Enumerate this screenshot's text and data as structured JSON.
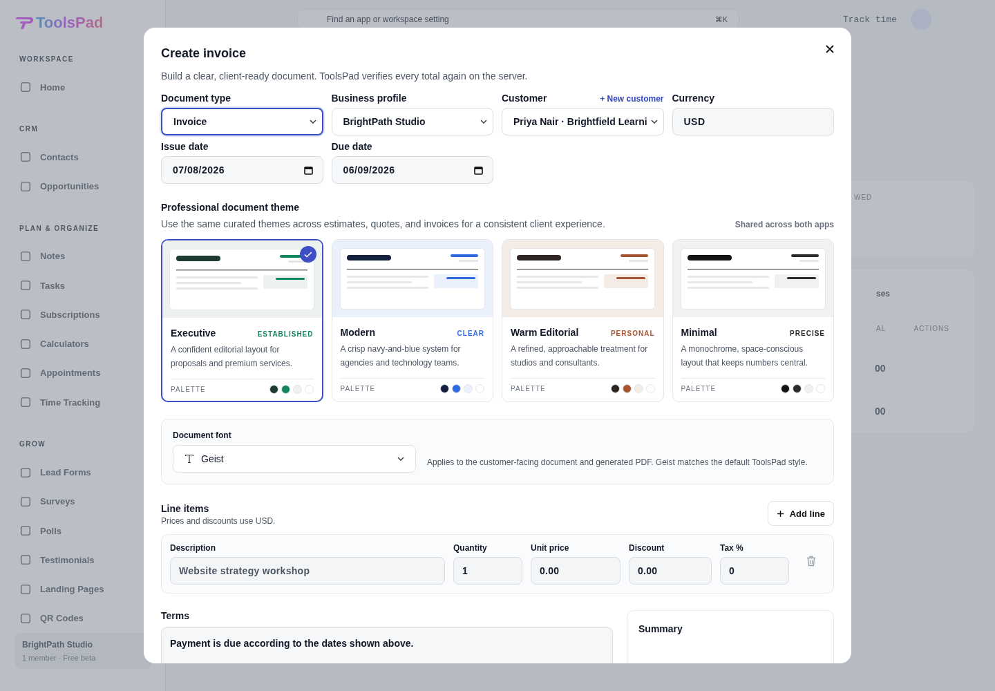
{
  "app": {
    "logo": "ToolsPad",
    "sidebar": [
      {
        "heading": "WORKSPACE",
        "items": [
          "Home"
        ]
      },
      {
        "heading": "CRM",
        "items": [
          "Contacts",
          "Opportunities"
        ]
      },
      {
        "heading": "PLAN & ORGANIZE",
        "items": [
          "Notes",
          "Tasks",
          "Subscriptions",
          "Calculators",
          "Appointments",
          "Time Tracking"
        ]
      },
      {
        "heading": "GROW",
        "items": [
          "Lead Forms",
          "Surveys",
          "Polls",
          "Testimonials",
          "Landing Pages",
          "QR Codes"
        ]
      }
    ],
    "workspace": {
      "name": "BrightPath Studio",
      "meta": "1 member · Free beta"
    },
    "search": {
      "placeholder": "Find an app or workspace setting",
      "shortcut": "⌘K"
    },
    "track_time": "Track time",
    "background_fragments": {
      "card_label": "WED",
      "select_value": "ses",
      "column_1": "AL",
      "column_2": "ACTIONS",
      "rows": [
        "00",
        "00"
      ]
    }
  },
  "dialog": {
    "title": "Create invoice",
    "subtitle": "Build a clear, client-ready document. ToolsPad verifies every total again on the server.",
    "fields": [
      {
        "label": "Document type",
        "kind": "select",
        "value": "Invoice",
        "focused": true
      },
      {
        "label": "Business profile",
        "kind": "select",
        "value": "BrightPath Studio",
        "focused": false
      },
      {
        "label": "Customer",
        "kind": "select",
        "value": "Priya Nair · Brightfield Learni",
        "focused": false,
        "action": "+ New customer"
      },
      {
        "label": "Currency",
        "kind": "text",
        "value": "USD",
        "focused": false
      },
      {
        "label": "Issue date",
        "kind": "date",
        "value": "07/08/2026",
        "focused": false
      },
      {
        "label": "Due date",
        "kind": "date",
        "value": "06/09/2026",
        "focused": false
      }
    ],
    "theme_section": {
      "title": "Professional document theme",
      "description": "Use the same curated themes across estimates, quotes, and invoices for a consistent client experience.",
      "note": "Shared across both apps"
    },
    "themes": [
      {
        "name": "Executive",
        "tag": "ESTABLISHED",
        "description": "A confident editorial layout for proposals and premium services.",
        "palette_label": "PALETTE",
        "selected": true,
        "palette": [
          {
            "color": "#1f3a2e"
          },
          {
            "color": "#12845f"
          },
          {
            "color": "#eef2ef"
          },
          {
            "color": "#ffffff"
          }
        ]
      },
      {
        "name": "Modern",
        "tag": "CLEAR",
        "description": "A crisp navy-and-blue system for agencies and technology teams.",
        "palette_label": "PALETTE",
        "selected": false,
        "palette": [
          {
            "color": "#13203f"
          },
          {
            "color": "#2f6ae0"
          },
          {
            "color": "#eaf1fc"
          },
          {
            "color": "#ffffff"
          }
        ]
      },
      {
        "name": "Warm Editorial",
        "tag": "PERSONAL",
        "description": "A refined, approachable treatment for studios and consultants.",
        "palette_label": "PALETTE",
        "selected": false,
        "palette": [
          {
            "color": "#2e2522"
          },
          {
            "color": "#a65431"
          },
          {
            "color": "#f6ece6"
          },
          {
            "color": "#ffffff"
          }
        ]
      },
      {
        "name": "Minimal",
        "tag": "PRECISE",
        "description": "A monochrome, space-conscious layout that keeps numbers central.",
        "palette_label": "PALETTE",
        "selected": false,
        "palette": [
          {
            "color": "#151515"
          },
          {
            "color": "#2b2b2b"
          },
          {
            "color": "#f1f1f1"
          },
          {
            "color": "#ffffff"
          }
        ]
      }
    ],
    "font": {
      "label": "Document font",
      "value": "Geist",
      "note": "Applies to the customer-facing document and generated PDF. Geist matches the default ToolsPad style."
    },
    "line_items": {
      "title": "Line items",
      "subtitle": "Prices and discounts use USD.",
      "add_button": "Add line",
      "columns": [
        "Description",
        "Quantity",
        "Unit price",
        "Discount",
        "Tax %"
      ],
      "rows": [
        [
          "Website strategy workshop",
          "1",
          "0.00",
          "0.00",
          "0"
        ]
      ]
    },
    "terms": {
      "label": "Terms",
      "value": "Payment is due according to the dates shown above."
    },
    "summary": {
      "title": "Summary"
    }
  }
}
